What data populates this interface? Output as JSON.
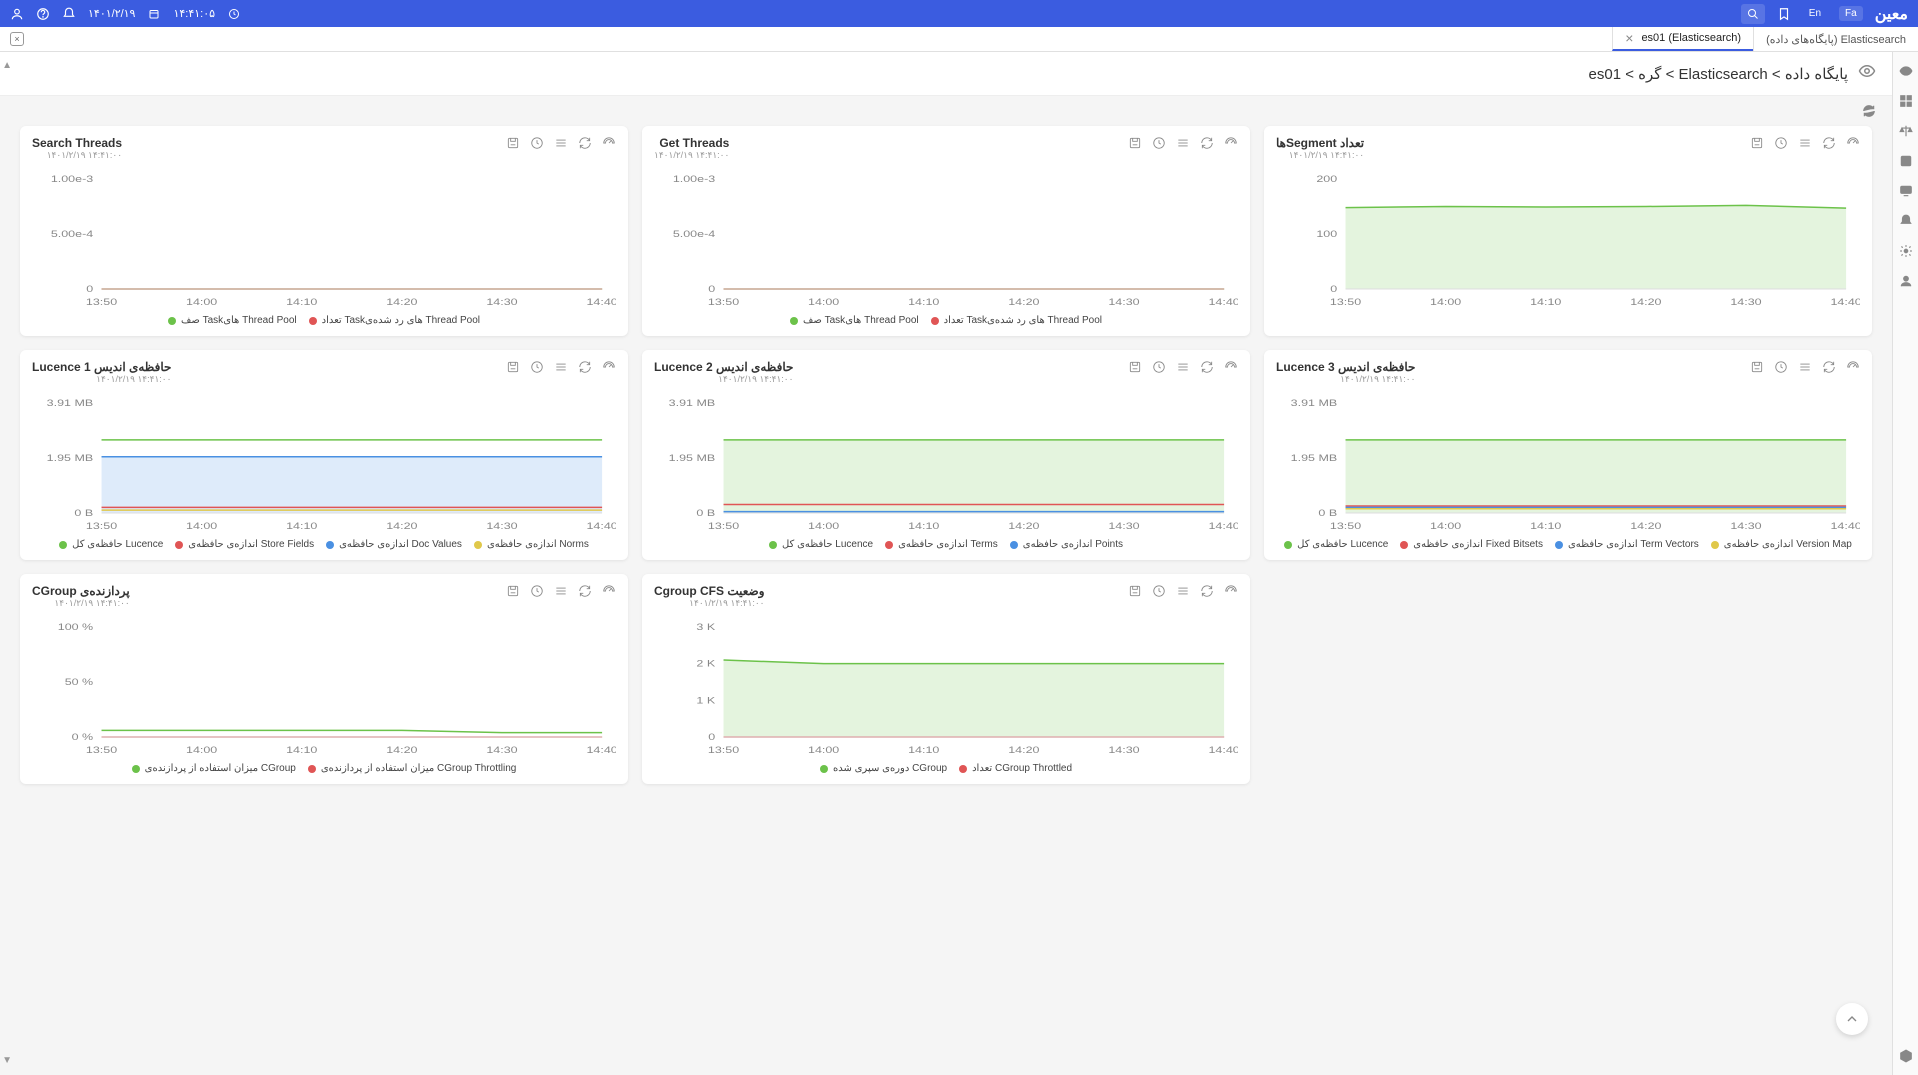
{
  "header": {
    "date": "۱۴۰۱/۲/۱۹",
    "time": "۱۴:۴۱:۰۵",
    "lang_en": "En",
    "lang_fa": "Fa",
    "logo": "معین"
  },
  "tabs": [
    {
      "label": "Elasticsearch (پایگاه‌های داده)",
      "active": false
    },
    {
      "label": "es01 (Elasticsearch)",
      "active": true
    }
  ],
  "breadcrumb": "پایگاه داده > Elasticsearch > گره > es01",
  "subtitle_ts": "۱۴۰۱/۲/۱۹  ۱۴:۴۱:۰۰",
  "x_ticks": [
    "13:50",
    "14:00",
    "14:10",
    "14:20",
    "14:30",
    "14:40"
  ],
  "colors": {
    "green": "#6cc24a",
    "red": "#e05555",
    "blue": "#4a90e2",
    "yellow": "#e0c84a"
  },
  "panels": [
    {
      "id": "search-threads",
      "title": "Search Threads",
      "y_ticks": [
        "1.00e-3",
        "5.00e-4",
        "0"
      ],
      "legend": [
        {
          "c": "green",
          "t": "صف Taskهای Thread Pool"
        },
        {
          "c": "red",
          "t": "تعداد Taskهای رد شده‌ی Thread Pool"
        }
      ],
      "chart_data": {
        "type": "line",
        "x": [
          "13:50",
          "14:00",
          "14:10",
          "14:20",
          "14:30",
          "14:40"
        ],
        "series": [
          {
            "name": "queue",
            "color": "green",
            "values": [
              0,
              0,
              0,
              0,
              0,
              0
            ]
          },
          {
            "name": "rejected",
            "color": "red",
            "values": [
              0,
              0,
              0,
              0,
              0,
              0
            ]
          }
        ],
        "ylim": [
          0,
          0.001
        ]
      }
    },
    {
      "id": "get-threads",
      "title": "Get Threads",
      "y_ticks": [
        "1.00e-3",
        "5.00e-4",
        "0"
      ],
      "legend": [
        {
          "c": "green",
          "t": "صف Taskهای Thread Pool"
        },
        {
          "c": "red",
          "t": "تعداد Taskهای رد شده‌ی Thread Pool"
        }
      ],
      "chart_data": {
        "type": "line",
        "x": [
          "13:50",
          "14:00",
          "14:10",
          "14:20",
          "14:30",
          "14:40"
        ],
        "series": [
          {
            "name": "queue",
            "color": "green",
            "values": [
              0,
              0,
              0,
              0,
              0,
              0
            ]
          },
          {
            "name": "rejected",
            "color": "red",
            "values": [
              0,
              0,
              0,
              0,
              0,
              0
            ]
          }
        ],
        "ylim": [
          0,
          0.001
        ]
      }
    },
    {
      "id": "segments",
      "title": "تعداد Segmentها",
      "y_ticks": [
        "200",
        "100",
        "0"
      ],
      "legend": [],
      "chart_data": {
        "type": "area",
        "x": [
          "13:50",
          "14:00",
          "14:10",
          "14:20",
          "14:30",
          "14:40"
        ],
        "series": [
          {
            "name": "segments",
            "color": "green",
            "values": [
              148,
              150,
              149,
              150,
              152,
              147
            ]
          }
        ],
        "ylim": [
          0,
          200
        ]
      }
    },
    {
      "id": "lucene1",
      "title": "حافظه‌ی اندیس Lucence 1",
      "y_ticks": [
        "3.91 MB",
        "1.95 MB",
        "0 B"
      ],
      "legend": [
        {
          "c": "green",
          "t": "حافظه‌ی کل Lucence"
        },
        {
          "c": "red",
          "t": "اندازه‌ی حافظه‌ی Store Fields"
        },
        {
          "c": "blue",
          "t": "اندازه‌ی حافظه‌ی Doc Values"
        },
        {
          "c": "yellow",
          "t": "اندازه‌ی حافظه‌ی Norms"
        }
      ],
      "chart_data": {
        "type": "line",
        "x": [
          "13:50",
          "14:00",
          "14:10",
          "14:20",
          "14:30",
          "14:40"
        ],
        "series": [
          {
            "name": "total",
            "color": "green",
            "values": [
              2.6,
              2.6,
              2.6,
              2.6,
              2.6,
              2.6
            ]
          },
          {
            "name": "docvalues",
            "color": "blue",
            "fill": true,
            "values": [
              2.0,
              2.0,
              2.0,
              2.0,
              2.0,
              2.0
            ]
          },
          {
            "name": "storefields",
            "color": "red",
            "values": [
              0.2,
              0.2,
              0.2,
              0.2,
              0.2,
              0.2
            ]
          },
          {
            "name": "norms",
            "color": "yellow",
            "values": [
              0.1,
              0.1,
              0.1,
              0.1,
              0.1,
              0.1
            ]
          }
        ],
        "ylim": [
          0,
          3.91
        ],
        "yunit": "MB"
      }
    },
    {
      "id": "lucene2",
      "title": "حافظه‌ی اندیس Lucence 2",
      "y_ticks": [
        "3.91 MB",
        "1.95 MB",
        "0 B"
      ],
      "legend": [
        {
          "c": "green",
          "t": "حافظه‌ی کل Lucence"
        },
        {
          "c": "red",
          "t": "اندازه‌ی حافظه‌ی Terms"
        },
        {
          "c": "blue",
          "t": "اندازه‌ی حافظه‌ی Points"
        }
      ],
      "chart_data": {
        "type": "line",
        "x": [
          "13:50",
          "14:00",
          "14:10",
          "14:20",
          "14:30",
          "14:40"
        ],
        "series": [
          {
            "name": "total",
            "color": "green",
            "fill": true,
            "values": [
              2.6,
              2.6,
              2.6,
              2.6,
              2.6,
              2.6
            ]
          },
          {
            "name": "terms",
            "color": "red",
            "values": [
              0.3,
              0.3,
              0.3,
              0.3,
              0.3,
              0.3
            ]
          },
          {
            "name": "points",
            "color": "blue",
            "values": [
              0.05,
              0.05,
              0.05,
              0.05,
              0.05,
              0.05
            ]
          }
        ],
        "ylim": [
          0,
          3.91
        ],
        "yunit": "MB"
      }
    },
    {
      "id": "lucene3",
      "title": "حافظه‌ی اندیس Lucence 3",
      "y_ticks": [
        "3.91 MB",
        "1.95 MB",
        "0 B"
      ],
      "legend": [
        {
          "c": "green",
          "t": "حافظه‌ی کل Lucence"
        },
        {
          "c": "red",
          "t": "اندازه‌ی حافظه‌ی Fixed Bitsets"
        },
        {
          "c": "blue",
          "t": "اندازه‌ی حافظه‌ی Term Vectors"
        },
        {
          "c": "yellow",
          "t": "اندازه‌ی حافظه‌ی Version Map"
        }
      ],
      "chart_data": {
        "type": "line",
        "x": [
          "13:50",
          "14:00",
          "14:10",
          "14:20",
          "14:30",
          "14:40"
        ],
        "series": [
          {
            "name": "total",
            "color": "green",
            "fill": true,
            "values": [
              2.6,
              2.6,
              2.6,
              2.6,
              2.6,
              2.6
            ]
          },
          {
            "name": "fixedbitsets",
            "color": "red",
            "values": [
              0.25,
              0.25,
              0.25,
              0.25,
              0.25,
              0.25
            ]
          },
          {
            "name": "termvectors",
            "color": "blue",
            "values": [
              0.2,
              0.2,
              0.2,
              0.2,
              0.2,
              0.2
            ]
          },
          {
            "name": "versionmap",
            "color": "yellow",
            "values": [
              0.15,
              0.15,
              0.15,
              0.15,
              0.15,
              0.15
            ]
          }
        ],
        "ylim": [
          0,
          3.91
        ],
        "yunit": "MB"
      }
    },
    {
      "id": "cgroup-cpu",
      "title": "پردازنده‌ی CGroup",
      "y_ticks": [
        "100 %",
        "50 %",
        "0 %"
      ],
      "legend": [
        {
          "c": "green",
          "t": "میزان استفاده از پردازنده‌ی CGroup"
        },
        {
          "c": "red",
          "t": "میزان استفاده از پردازنده‌ی CGroup Throttling"
        }
      ],
      "chart_data": {
        "type": "line",
        "x": [
          "13:50",
          "14:00",
          "14:10",
          "14:20",
          "14:30",
          "14:40"
        ],
        "series": [
          {
            "name": "usage",
            "color": "green",
            "values": [
              6,
              6,
              6,
              6,
              4,
              4
            ]
          },
          {
            "name": "throttling",
            "color": "red",
            "values": [
              0,
              0,
              0,
              0,
              0,
              0
            ]
          }
        ],
        "ylim": [
          0,
          100
        ],
        "yunit": "%"
      }
    },
    {
      "id": "cgroup-cfs",
      "title": "وضعیت Cgroup CFS",
      "y_ticks": [
        "3 K",
        "2 K",
        "1 K",
        "0"
      ],
      "legend": [
        {
          "c": "green",
          "t": "دوره‌ی سپری شده CGroup"
        },
        {
          "c": "red",
          "t": "تعداد CGroup Throttled"
        }
      ],
      "chart_data": {
        "type": "line",
        "x": [
          "13:50",
          "14:00",
          "14:10",
          "14:20",
          "14:30",
          "14:40"
        ],
        "series": [
          {
            "name": "periods",
            "color": "green",
            "fill": true,
            "values": [
              2100,
              2000,
              2000,
              2000,
              2000,
              2000
            ]
          },
          {
            "name": "throttled",
            "color": "red",
            "values": [
              0,
              0,
              0,
              0,
              0,
              0
            ]
          }
        ],
        "ylim": [
          0,
          3000
        ]
      }
    }
  ]
}
